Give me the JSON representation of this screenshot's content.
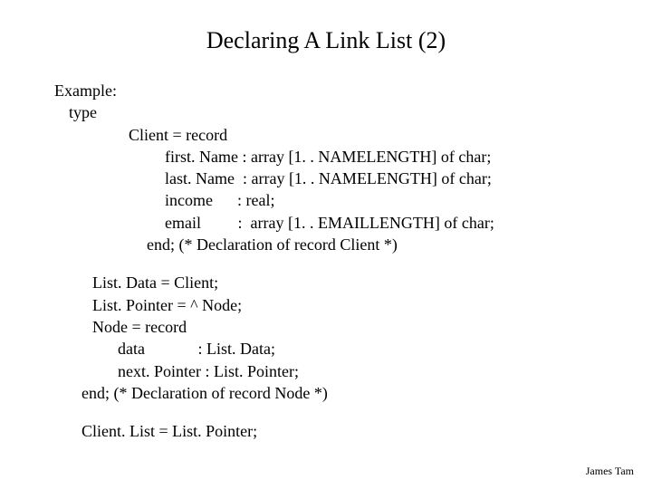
{
  "title": "Declaring A Link List (2)",
  "example_label": "Example:",
  "type_label": "type",
  "client": {
    "decl": "Client =  record",
    "firstName": "first. Name : array [1. . NAMELENGTH] of char;",
    "lastName": "last. Name  : array [1. . NAMELENGTH] of char;",
    "income": "income      : real;",
    "email": "email         :  array [1. . EMAILLENGTH] of char;",
    "end": "end; (* Declaration of record Client *)"
  },
  "list": {
    "data": "List. Data = Client;",
    "pointer": "List. Pointer = ^ Node;",
    "node": "Node = record",
    "field_data": "data             : List. Data;",
    "field_next": "next. Pointer : List. Pointer;",
    "end": "end; (* Declaration of record Node *)"
  },
  "clientlist": "Client. List = List. Pointer;",
  "footer": "James Tam"
}
